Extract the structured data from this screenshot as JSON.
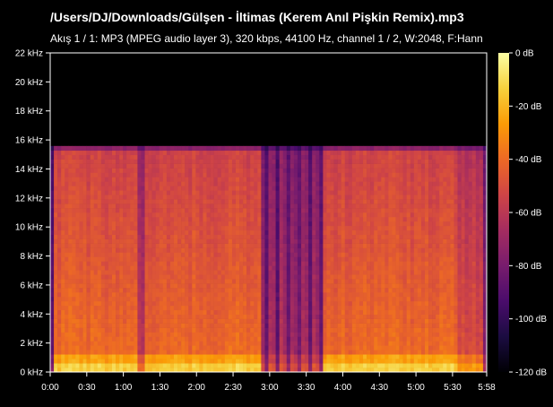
{
  "title": "/Users/DJ/Downloads/Gülşen - İltimas (Kerem Anıl Pişkin Remix).mp3",
  "subtitle": "Akış 1 / 1: MP3 (MPEG audio layer 3), 320 kbps, 44100 Hz, channel 1 / 2, W:2048, F:Hann",
  "chart_data": {
    "type": "heatmap",
    "x_ticks": [
      "0:00",
      "0:30",
      "1:00",
      "1:30",
      "2:00",
      "2:30",
      "3:00",
      "3:30",
      "4:00",
      "4:30",
      "5:00",
      "5:30",
      "5:58"
    ],
    "x_range_seconds": [
      0,
      358
    ],
    "y_ticks": [
      "0 kHz",
      "2 kHz",
      "4 kHz",
      "6 kHz",
      "8 kHz",
      "10 kHz",
      "12 kHz",
      "14 kHz",
      "16 kHz",
      "18 kHz",
      "20 kHz",
      "22 kHz"
    ],
    "y_range_khz": [
      0,
      22
    ],
    "colorbar_ticks": [
      "0 dB",
      "-20 dB",
      "-40 dB",
      "-60 dB",
      "-80 dB",
      "-100 dB",
      "-120 dB"
    ],
    "colorbar_range_db": [
      -120,
      0
    ],
    "lowpass_cutoff_khz": 15.7,
    "colormap": [
      "#000004",
      "#1b0c41",
      "#4a0c6b",
      "#781c6d",
      "#a52c60",
      "#cf4446",
      "#ed6925",
      "#fb9b06",
      "#f7d13d",
      "#fcffa4"
    ]
  }
}
